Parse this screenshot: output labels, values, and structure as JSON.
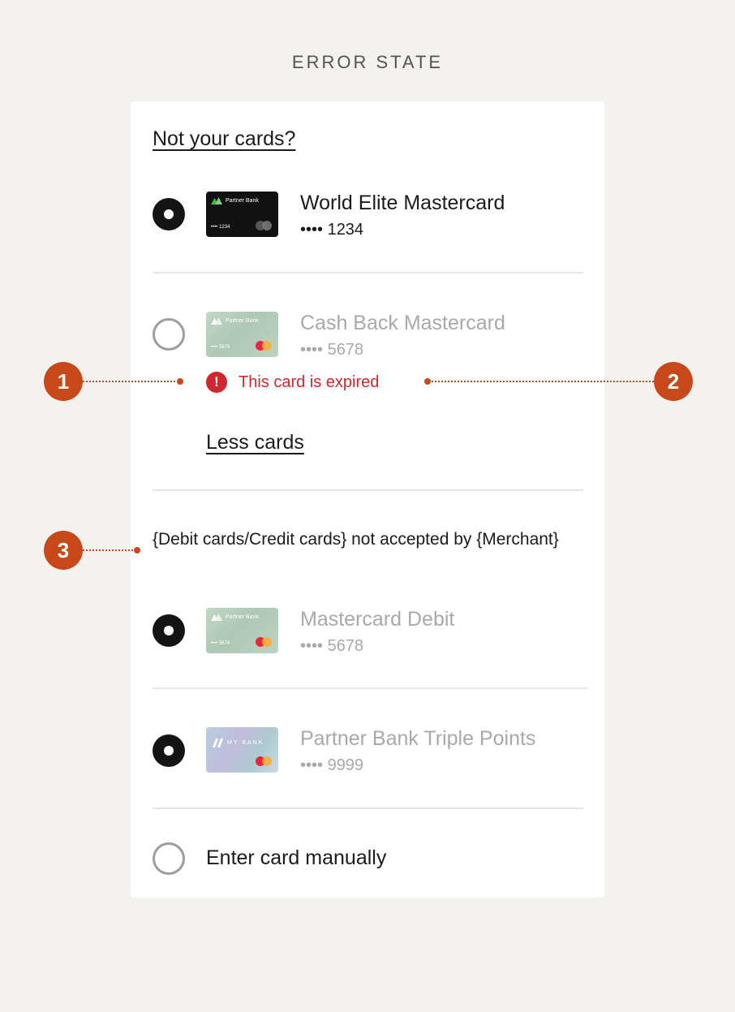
{
  "page": {
    "title": "ERROR STATE"
  },
  "links": {
    "not_your_cards": "Not your cards?",
    "less_cards": "Less cards"
  },
  "cards": [
    {
      "name": "World Elite Mastercard",
      "mask": "•••• 1234",
      "selected": true,
      "disabled": false,
      "art": {
        "bank": "Partner Bank",
        "number": "•••• 1234",
        "style": "black"
      }
    },
    {
      "name": "Cash Back Mastercard",
      "mask": "•••• 5678",
      "selected": false,
      "disabled": true,
      "art": {
        "bank": "Partner Bank",
        "number": "•••• 5678",
        "style": "green"
      },
      "error": "This card is expired"
    },
    {
      "name": "Mastercard Debit",
      "mask": "•••• 5678",
      "selected": true,
      "disabled": true,
      "art": {
        "bank": "Partner Bank",
        "number": "•••• 5678",
        "style": "green"
      }
    },
    {
      "name": "Partner Bank Triple Points",
      "mask": "•••• 9999",
      "selected": true,
      "disabled": true,
      "art": {
        "bank": "MY BANK",
        "style": "holographic"
      }
    }
  ],
  "notice": "{Debit cards/Credit cards} not accepted by {Merchant}",
  "manual_entry": {
    "label": "Enter card manually",
    "selected": false
  },
  "annotations": [
    {
      "label": "1"
    },
    {
      "label": "2"
    },
    {
      "label": "3"
    }
  ],
  "colors": {
    "background": "#f3f2ee",
    "error": "#d0262f",
    "annotation": "#c8481a",
    "radio_selected": "#141414",
    "disabled_text": "#a9a9a9",
    "mastercard_red": "#eb001b",
    "mastercard_orange": "#f79e1b"
  }
}
